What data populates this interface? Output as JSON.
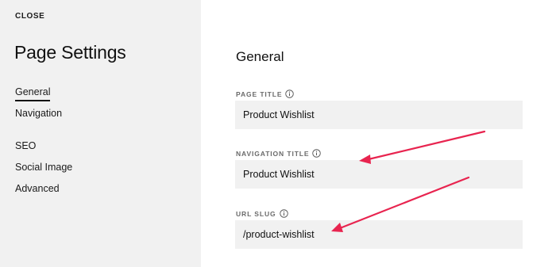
{
  "sidebar": {
    "close_label": "CLOSE",
    "title": "Page Settings",
    "items": [
      {
        "label": "General",
        "active": true
      },
      {
        "label": "Navigation"
      },
      {
        "label": "SEO"
      },
      {
        "label": "Social Image"
      },
      {
        "label": "Advanced"
      }
    ]
  },
  "main": {
    "section_title": "General",
    "fields": [
      {
        "label": "PAGE TITLE",
        "value": "Product Wishlist",
        "icon": "info-icon"
      },
      {
        "label": "NAVIGATION TITLE",
        "value": "Product Wishlist",
        "icon": "info-icon"
      },
      {
        "label": "URL SLUG",
        "value": "/product-wishlist",
        "icon": "info-icon"
      }
    ]
  },
  "colors": {
    "sidebar_bg": "#f1f1f1",
    "input_bg": "#f1f1f1",
    "annotation_arrow": "#e8244f"
  }
}
